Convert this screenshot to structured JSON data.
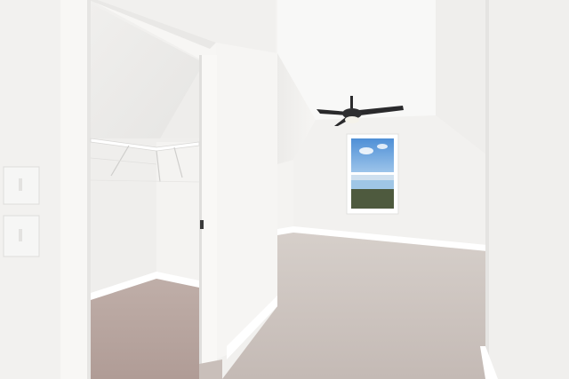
{
  "scene": {
    "subject": "empty-attic-bedroom",
    "visible_text": []
  },
  "elements": {
    "walk_in_closet": {
      "icon": "closet-opening",
      "has_wire_shelf": true
    },
    "ceiling_fan": {
      "icon": "ceiling-fan-icon",
      "blades": 3,
      "light_kit": true
    },
    "window": {
      "icon": "window-icon",
      "panes": 2
    },
    "wall_plates": {
      "count": 2,
      "type": "light-switch"
    },
    "flooring": {
      "type": "carpet",
      "color": "#c9bfb9"
    }
  },
  "colors": {
    "wall": "#f3f2f0",
    "wall_shadow": "#e4e3e1",
    "ceiling": "#f7f7f6",
    "carpet": "#cbc2bd",
    "carpet_closet": "#b8a7a1",
    "trim": "#ffffff",
    "sky": "#5f9fdc",
    "fan": "#2a2a2c"
  }
}
